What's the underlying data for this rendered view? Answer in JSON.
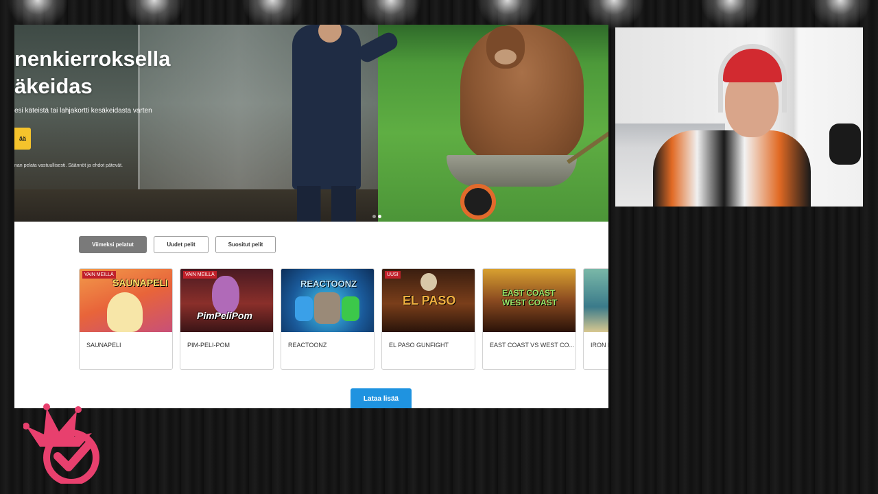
{
  "hero": {
    "title_line1": "nenkierroksella",
    "title_line2": "äkeidas",
    "subtitle": "esi käteistä tai lahjakortti kesäkeidasta varten",
    "button_label": "ää",
    "note": "nan pelata vastuullisesti. Säännöt ja ehdot pätevät."
  },
  "tabs": [
    {
      "label": "Viimeksi pelatut",
      "active": true
    },
    {
      "label": "Uudet pelit",
      "active": false
    },
    {
      "label": "Suositut pelit",
      "active": false
    }
  ],
  "games": [
    {
      "title": "SAUNAPELI",
      "badge": "VAIN MEILLÄ",
      "art": "SAUNAPELI"
    },
    {
      "title": "PIM-PELI-POM",
      "badge": "VAIN MEILLÄ",
      "art": "PimPeliPom"
    },
    {
      "title": "REACTOONZ",
      "badge": "",
      "art": "REACTOONZ"
    },
    {
      "title": "EL PASO GUNFIGHT",
      "badge": "UUSI",
      "art": "EL PASO"
    },
    {
      "title": "EAST COAST VS WEST CO...",
      "badge": "",
      "art": "EAST COAST WEST COAST"
    },
    {
      "title": "IRON B",
      "badge": "",
      "art": ""
    }
  ],
  "load_more_label": "Lataa lisää",
  "colors": {
    "tab_active": "#7a7a7a",
    "load_more": "#1f93e0",
    "badge": "#c0202a",
    "hero_button": "#f5c32c",
    "logo": "#e8406e"
  },
  "icons": {
    "logo": "crown-checkmark-logo",
    "slider": "carousel-dots"
  }
}
